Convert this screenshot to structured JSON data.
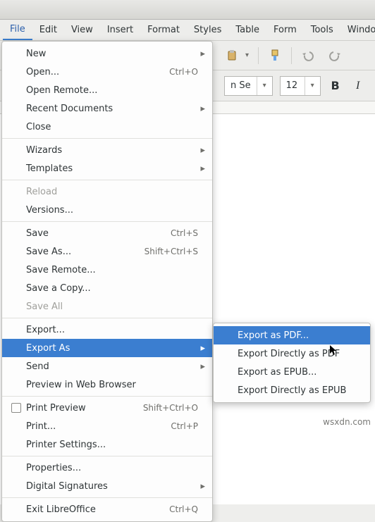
{
  "menubar": [
    "File",
    "Edit",
    "View",
    "Insert",
    "Format",
    "Styles",
    "Table",
    "Form",
    "Tools",
    "Window"
  ],
  "active_menu_index": 0,
  "format_bar": {
    "font_name_fragment": "n Se",
    "font_size": "12",
    "bold": "B",
    "italic": "I"
  },
  "file_menu": [
    {
      "type": "item",
      "label": "New",
      "accel": "",
      "arrow": true
    },
    {
      "type": "item",
      "label": "Open...",
      "accel": "Ctrl+O"
    },
    {
      "type": "item",
      "label": "Open Remote..."
    },
    {
      "type": "item",
      "label": "Recent Documents",
      "arrow": true
    },
    {
      "type": "item",
      "label": "Close"
    },
    {
      "type": "sep"
    },
    {
      "type": "item",
      "label": "Wizards",
      "arrow": true
    },
    {
      "type": "item",
      "label": "Templates",
      "arrow": true
    },
    {
      "type": "sep"
    },
    {
      "type": "item",
      "label": "Reload",
      "disabled": true
    },
    {
      "type": "item",
      "label": "Versions..."
    },
    {
      "type": "sep"
    },
    {
      "type": "item",
      "label": "Save",
      "accel": "Ctrl+S"
    },
    {
      "type": "item",
      "label": "Save As...",
      "accel": "Shift+Ctrl+S"
    },
    {
      "type": "item",
      "label": "Save Remote..."
    },
    {
      "type": "item",
      "label": "Save a Copy..."
    },
    {
      "type": "item",
      "label": "Save All",
      "disabled": true
    },
    {
      "type": "sep"
    },
    {
      "type": "item",
      "label": "Export..."
    },
    {
      "type": "item",
      "label": "Export As",
      "arrow": true,
      "highlight": true
    },
    {
      "type": "item",
      "label": "Send",
      "arrow": true
    },
    {
      "type": "item",
      "label": "Preview in Web Browser"
    },
    {
      "type": "sep"
    },
    {
      "type": "item",
      "label": "Print Preview",
      "accel": "Shift+Ctrl+O",
      "checkbox": true
    },
    {
      "type": "item",
      "label": "Print...",
      "accel": "Ctrl+P"
    },
    {
      "type": "item",
      "label": "Printer Settings..."
    },
    {
      "type": "sep"
    },
    {
      "type": "item",
      "label": "Properties..."
    },
    {
      "type": "item",
      "label": "Digital Signatures",
      "arrow": true
    },
    {
      "type": "sep"
    },
    {
      "type": "item",
      "label": "Exit LibreOffice",
      "accel": "Ctrl+Q"
    }
  ],
  "export_submenu": [
    {
      "label": "Export as PDF...",
      "highlight": true
    },
    {
      "label": "Export Directly as PDF"
    },
    {
      "label": "Export as EPUB..."
    },
    {
      "label": "Export Directly as EPUB"
    }
  ],
  "watermark": "wsxdn.com"
}
